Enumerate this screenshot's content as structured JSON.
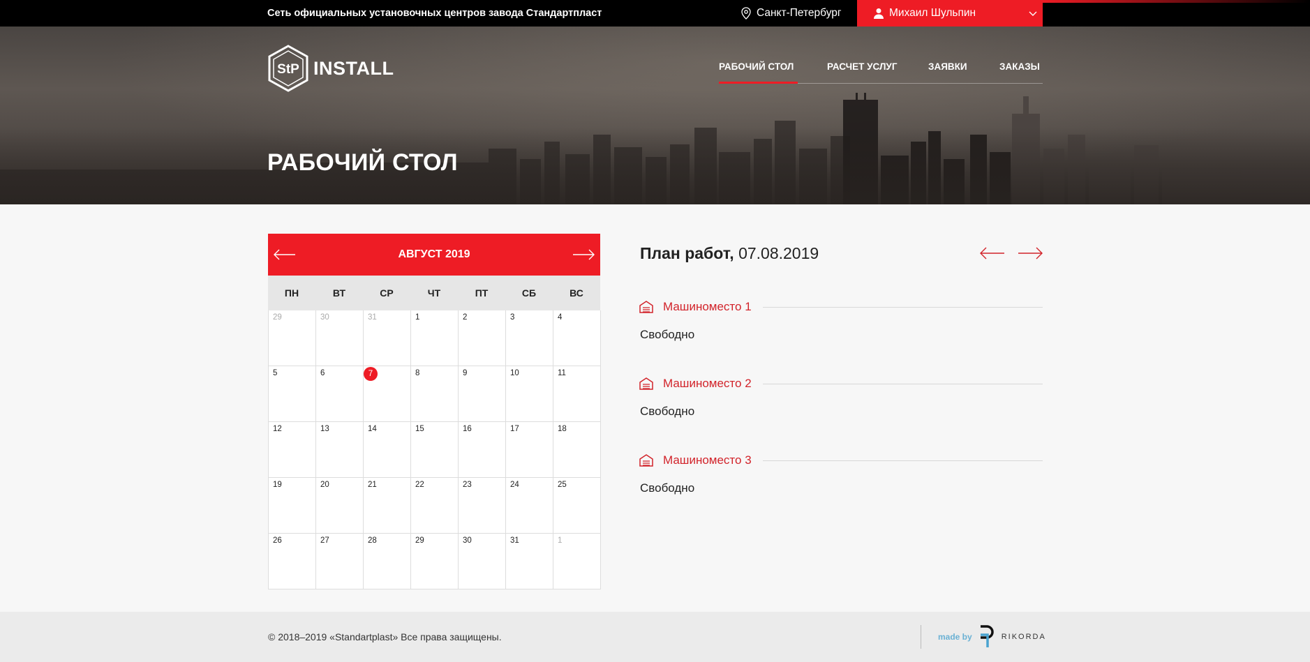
{
  "topbar": {
    "title": "Сеть официальных установочных центров завода Стандартпласт",
    "city": "Санкт-Петербург",
    "user": "Михаил Шульпин"
  },
  "header": {
    "logo_mark": "StP",
    "logo_text": "INSTALL",
    "nav": [
      {
        "label": "РАБОЧИЙ СТОЛ",
        "active": true
      },
      {
        "label": "РАСЧЕТ УСЛУГ",
        "active": false
      },
      {
        "label": "ЗАЯВКИ",
        "active": false
      },
      {
        "label": "ЗАКАЗЫ",
        "active": false
      }
    ],
    "page_title": "РАБОЧИЙ СТОЛ"
  },
  "calendar": {
    "month": "АВГУСТ 2019",
    "weekdays": [
      "ПН",
      "ВТ",
      "СР",
      "ЧТ",
      "ПТ",
      "СБ",
      "ВС"
    ],
    "days": [
      {
        "n": "29",
        "m": true
      },
      {
        "n": "30",
        "m": true
      },
      {
        "n": "31",
        "m": true
      },
      {
        "n": "1"
      },
      {
        "n": "2"
      },
      {
        "n": "3"
      },
      {
        "n": "4"
      },
      {
        "n": "5"
      },
      {
        "n": "6"
      },
      {
        "n": "7",
        "t": true
      },
      {
        "n": "8"
      },
      {
        "n": "9"
      },
      {
        "n": "10"
      },
      {
        "n": "11"
      },
      {
        "n": "12"
      },
      {
        "n": "13"
      },
      {
        "n": "14"
      },
      {
        "n": "15"
      },
      {
        "n": "16"
      },
      {
        "n": "17"
      },
      {
        "n": "18"
      },
      {
        "n": "19"
      },
      {
        "n": "20"
      },
      {
        "n": "21"
      },
      {
        "n": "22"
      },
      {
        "n": "23"
      },
      {
        "n": "24"
      },
      {
        "n": "25"
      },
      {
        "n": "26"
      },
      {
        "n": "27"
      },
      {
        "n": "28"
      },
      {
        "n": "29"
      },
      {
        "n": "30"
      },
      {
        "n": "31"
      },
      {
        "n": "1",
        "m": true
      }
    ]
  },
  "plan": {
    "label": "План работ,",
    "date": "07.08.2019",
    "slots": [
      {
        "name": "Машиноместо 1",
        "status": "Свободно"
      },
      {
        "name": "Машиноместо 2",
        "status": "Свободно"
      },
      {
        "name": "Машиноместо 3",
        "status": "Свободно"
      }
    ]
  },
  "footer": {
    "copyright": "© 2018–2019 «Standartplast» Все права защищены.",
    "made_by": "made by",
    "studio": "RIKORDA"
  },
  "colors": {
    "accent": "#ee1c25",
    "slot_text": "#d2232a"
  },
  "icons": [
    "location-pin-icon",
    "user-icon",
    "chevron-down-icon",
    "arrow-left-icon",
    "arrow-right-icon",
    "garage-icon"
  ]
}
